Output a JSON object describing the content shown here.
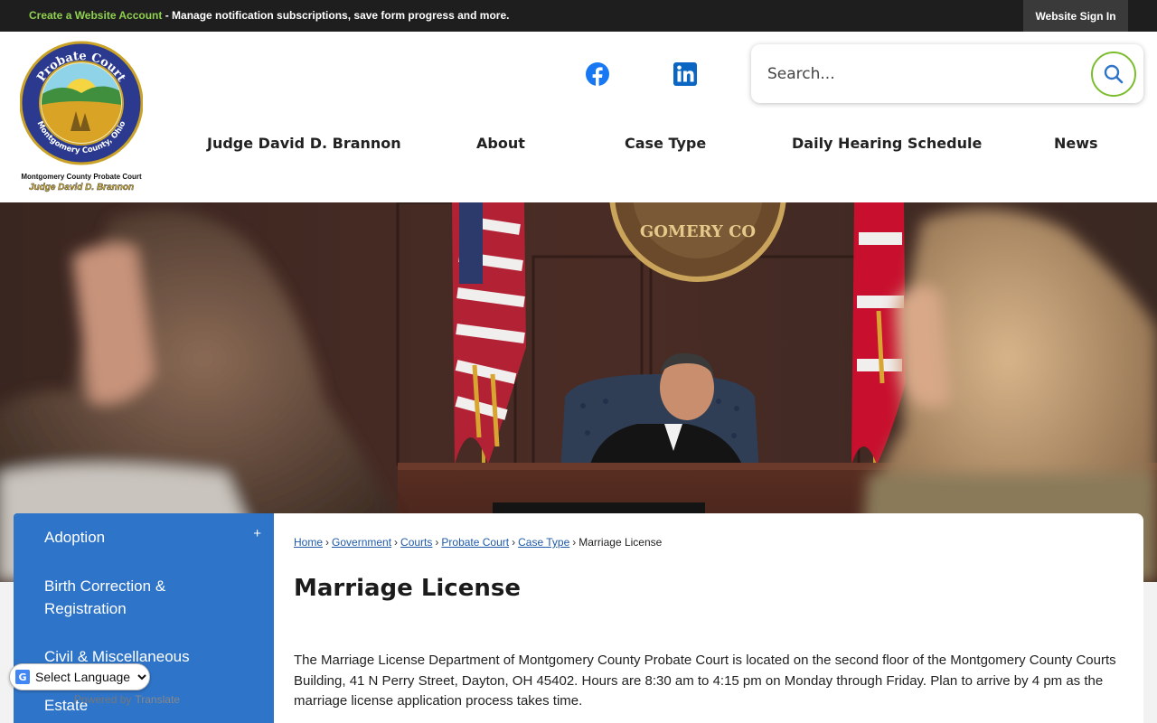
{
  "topbar": {
    "link_text": "Create a Website Account",
    "message": " - Manage notification subscriptions, save form progress and more.",
    "signin_label": "Website Sign In"
  },
  "logo": {
    "seal_top_text": "Probate Court",
    "seal_bottom_text": "Montgomery County, Ohio",
    "caption_line1": "Montgomery County Probate Court",
    "caption_line2": "Judge David D. Brannon"
  },
  "social": {
    "facebook_icon": "facebook-icon",
    "linkedin_icon": "linkedin-icon"
  },
  "search": {
    "placeholder": "Search...",
    "icon": "search-icon",
    "accent": "#7bbd2f"
  },
  "nav": {
    "items": [
      {
        "label": "Judge David D. Brannon"
      },
      {
        "label": "About"
      },
      {
        "label": "Case Type"
      },
      {
        "label": "Daily Hearing Schedule"
      },
      {
        "label": "News"
      }
    ]
  },
  "hero": {
    "seal_text": "GOMERY CO"
  },
  "sidebar": {
    "color": "#2e74c9",
    "expand_symbol": "+",
    "items": [
      {
        "label": "Adoption"
      },
      {
        "label": "Birth Correction & Registration"
      },
      {
        "label": "Civil & Miscellaneous"
      },
      {
        "label": "Estate"
      }
    ]
  },
  "breadcrumb": {
    "items": [
      {
        "label": "Home"
      },
      {
        "label": "Government"
      },
      {
        "label": "Courts"
      },
      {
        "label": "Probate Court"
      },
      {
        "label": "Case Type"
      }
    ],
    "separator": "›",
    "current": "Marriage License"
  },
  "page": {
    "title": "Marriage License",
    "body": "The Marriage License Department of Montgomery County Probate Court is located on the second floor of the Montgomery County Courts Building, 41 N Perry Street, Dayton, OH 45402. Hours are 8:30 am to 4:15 pm on Monday through Friday. Plan to arrive by 4 pm as the marriage license application process takes time."
  },
  "translate": {
    "select_label": "Select Language",
    "powered_by": "Powered by",
    "translate_label": "Translate"
  }
}
